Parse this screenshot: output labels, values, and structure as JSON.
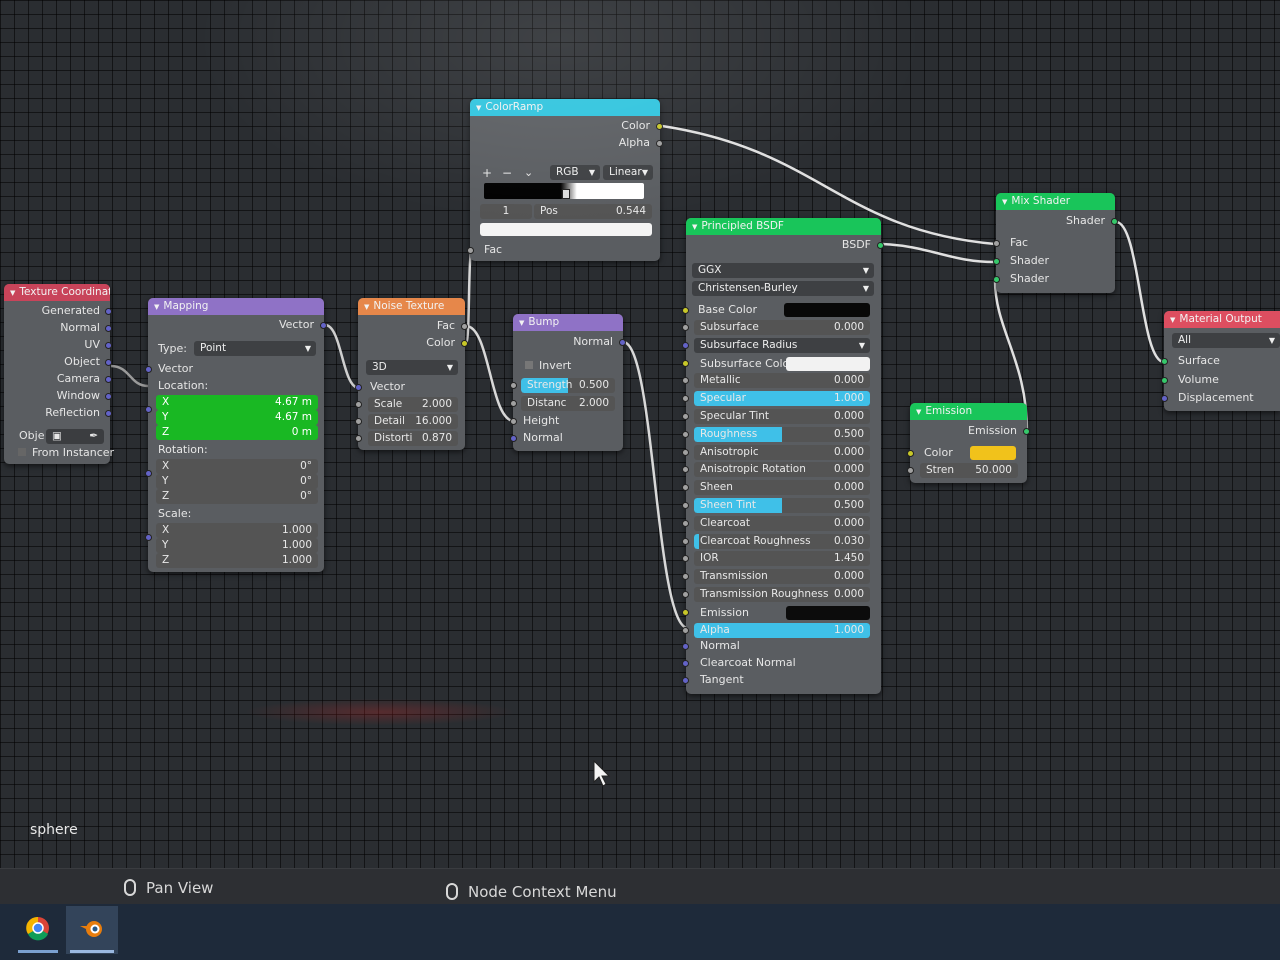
{
  "object_label": "sphere",
  "status_bar": {
    "hint1": "Pan View",
    "hint2": "Node Context Menu"
  },
  "taskbar": {
    "apps": [
      {
        "icon": "chrome-icon"
      },
      {
        "icon": "blender-icon"
      }
    ]
  },
  "colors": {
    "header_input": "#c8445a",
    "header_vector": "#8f72c6",
    "header_texture": "#e6874a",
    "header_converter": "#2fc4de",
    "header_shader": "#19c55a",
    "header_output": "#dd4e60",
    "field_green": "#19b823",
    "field_cyan": "#3fc0e8",
    "emission_color": "#f1c21b"
  },
  "nodes": {
    "texture_coordinate": {
      "title": "Texture Coordinate",
      "outputs": [
        "Generated",
        "Normal",
        "UV",
        "Object",
        "Camera",
        "Window",
        "Reflection"
      ],
      "object_label": "Obje",
      "from_instancer": "From Instancer"
    },
    "mapping": {
      "title": "Mapping",
      "output": "Vector",
      "type_label": "Type:",
      "type_value": "Point",
      "vector_input": "Vector",
      "location_label": "Location:",
      "location": [
        {
          "axis": "X",
          "value": "4.67 m"
        },
        {
          "axis": "Y",
          "value": "4.67 m"
        },
        {
          "axis": "Z",
          "value": "0 m"
        }
      ],
      "rotation_label": "Rotation:",
      "rotation": [
        {
          "axis": "X",
          "value": "0°"
        },
        {
          "axis": "Y",
          "value": "0°"
        },
        {
          "axis": "Z",
          "value": "0°"
        }
      ],
      "scale_label": "Scale:",
      "scale": [
        {
          "axis": "X",
          "value": "1.000"
        },
        {
          "axis": "Y",
          "value": "1.000"
        },
        {
          "axis": "Z",
          "value": "1.000"
        }
      ]
    },
    "noise_texture": {
      "title": "Noise Texture",
      "outputs": [
        "Fac",
        "Color"
      ],
      "dimensions": "3D",
      "vector_input": "Vector",
      "fields": [
        {
          "label": "Scale",
          "value": "2.000"
        },
        {
          "label": "Detail",
          "value": "16.000"
        },
        {
          "label": "Distorti",
          "value": "0.870"
        }
      ]
    },
    "color_ramp": {
      "title": "ColorRamp",
      "outputs": [
        "Color",
        "Alpha"
      ],
      "controls": [
        "+",
        "−",
        "⌄"
      ],
      "color_mode": "RGB",
      "interpolation": "Linear",
      "index": "1",
      "pos_label": "Pos",
      "pos_value": "0.544",
      "input": "Fac"
    },
    "bump": {
      "title": "Bump",
      "output": "Normal",
      "invert": "Invert",
      "fields": [
        {
          "label": "Strength",
          "value": "0.500",
          "fill": 0.5
        },
        {
          "label": "Distanc",
          "value": "2.000",
          "fill": 0
        }
      ],
      "inputs": [
        "Height",
        "Normal"
      ]
    },
    "principled": {
      "title": "Principled BSDF",
      "output": "BSDF",
      "distribution": "GGX",
      "subsurface_method": "Christensen-Burley",
      "base_color_label": "Base Color",
      "rows": [
        {
          "label": "Subsurface",
          "value": "0.000",
          "fill": 0
        },
        {
          "label": "Subsurface Radius",
          "value": "",
          "fill": 0,
          "dropdown": true
        },
        {
          "label": "Subsurface Color",
          "value": "",
          "fill": 0,
          "swatch": "#f2f2f2"
        },
        {
          "label": "Metallic",
          "value": "0.000",
          "fill": 0
        },
        {
          "label": "Specular",
          "value": "1.000",
          "fill": 1
        },
        {
          "label": "Specular Tint",
          "value": "0.000",
          "fill": 0
        },
        {
          "label": "Roughness",
          "value": "0.500",
          "fill": 0.5
        },
        {
          "label": "Anisotropic",
          "value": "0.000",
          "fill": 0
        },
        {
          "label": "Anisotropic Rotation",
          "value": "0.000",
          "fill": 0
        },
        {
          "label": "Sheen",
          "value": "0.000",
          "fill": 0
        },
        {
          "label": "Sheen Tint",
          "value": "0.500",
          "fill": 0.5
        },
        {
          "label": "Clearcoat",
          "value": "0.000",
          "fill": 0
        },
        {
          "label": "Clearcoat Roughness",
          "value": "0.030",
          "fill": 0.03
        },
        {
          "label": "IOR",
          "value": "1.450",
          "fill": 0
        },
        {
          "label": "Transmission",
          "value": "0.000",
          "fill": 0
        },
        {
          "label": "Transmission Roughness",
          "value": "0.000",
          "fill": 0
        },
        {
          "label": "Emission",
          "value": "",
          "fill": 0,
          "swatch": "#0c0c0c"
        },
        {
          "label": "Alpha",
          "value": "1.000",
          "fill": 1
        }
      ],
      "vector_inputs": [
        "Normal",
        "Clearcoat Normal",
        "Tangent"
      ]
    },
    "mix_shader": {
      "title": "Mix Shader",
      "output": "Shader",
      "inputs": [
        "Fac",
        "Shader",
        "Shader"
      ]
    },
    "emission": {
      "title": "Emission",
      "output": "Emission",
      "color_label": "Color",
      "strength_label": "Stren",
      "strength_value": "50.000"
    },
    "material_output": {
      "title": "Material Output",
      "target": "All",
      "inputs": [
        "Surface",
        "Volume",
        "Displacement"
      ]
    }
  }
}
